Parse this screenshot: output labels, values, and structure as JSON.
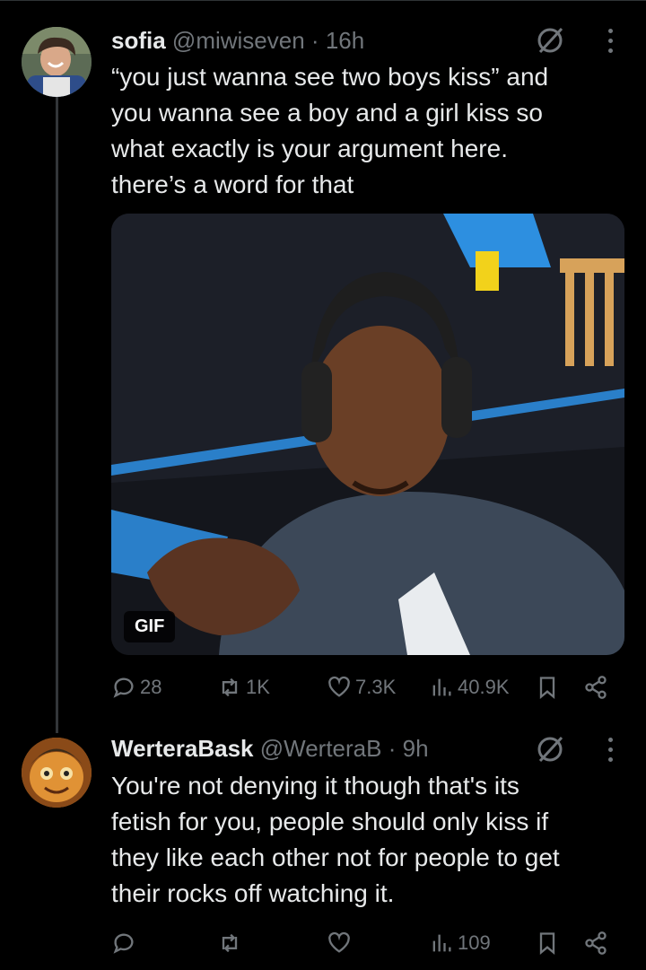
{
  "tweets": [
    {
      "name": "sofia",
      "handle": "@miwiseven",
      "separator": "·",
      "time": "16h",
      "text_lines": [
        "“you just wanna see two boys kiss” and",
        "you wanna see a boy and a girl kiss so",
        "what exactly is your argument here.",
        "there’s a word for that"
      ],
      "media": {
        "badge": "GIF"
      },
      "stats": {
        "replies": "28",
        "reposts": "1K",
        "likes": "7.3K",
        "views": "40.9K"
      }
    },
    {
      "name": "WerteraBask",
      "handle": "@WerteraB",
      "separator": "·",
      "time": "9h",
      "text_lines": [
        "You're not denying it though that's its",
        "fetish for you, people should only kiss if",
        "they like each other not for people to get",
        "their rocks off watching it."
      ],
      "stats": {
        "replies": "",
        "reposts": "",
        "likes": "",
        "views": "109"
      }
    }
  ],
  "icons": {
    "reply": "speech-bubble-icon",
    "repost": "repost-arrows-icon",
    "like": "heart-icon",
    "views": "bar-chart-icon",
    "bookmark": "bookmark-icon",
    "share": "share-nodes-icon",
    "grok": "grok-slash-icon",
    "more": "more-vertical-icon"
  },
  "colors": {
    "background": "#000000",
    "text": "#e7e9ea",
    "muted": "#71767b",
    "divider": "#2f3336"
  }
}
